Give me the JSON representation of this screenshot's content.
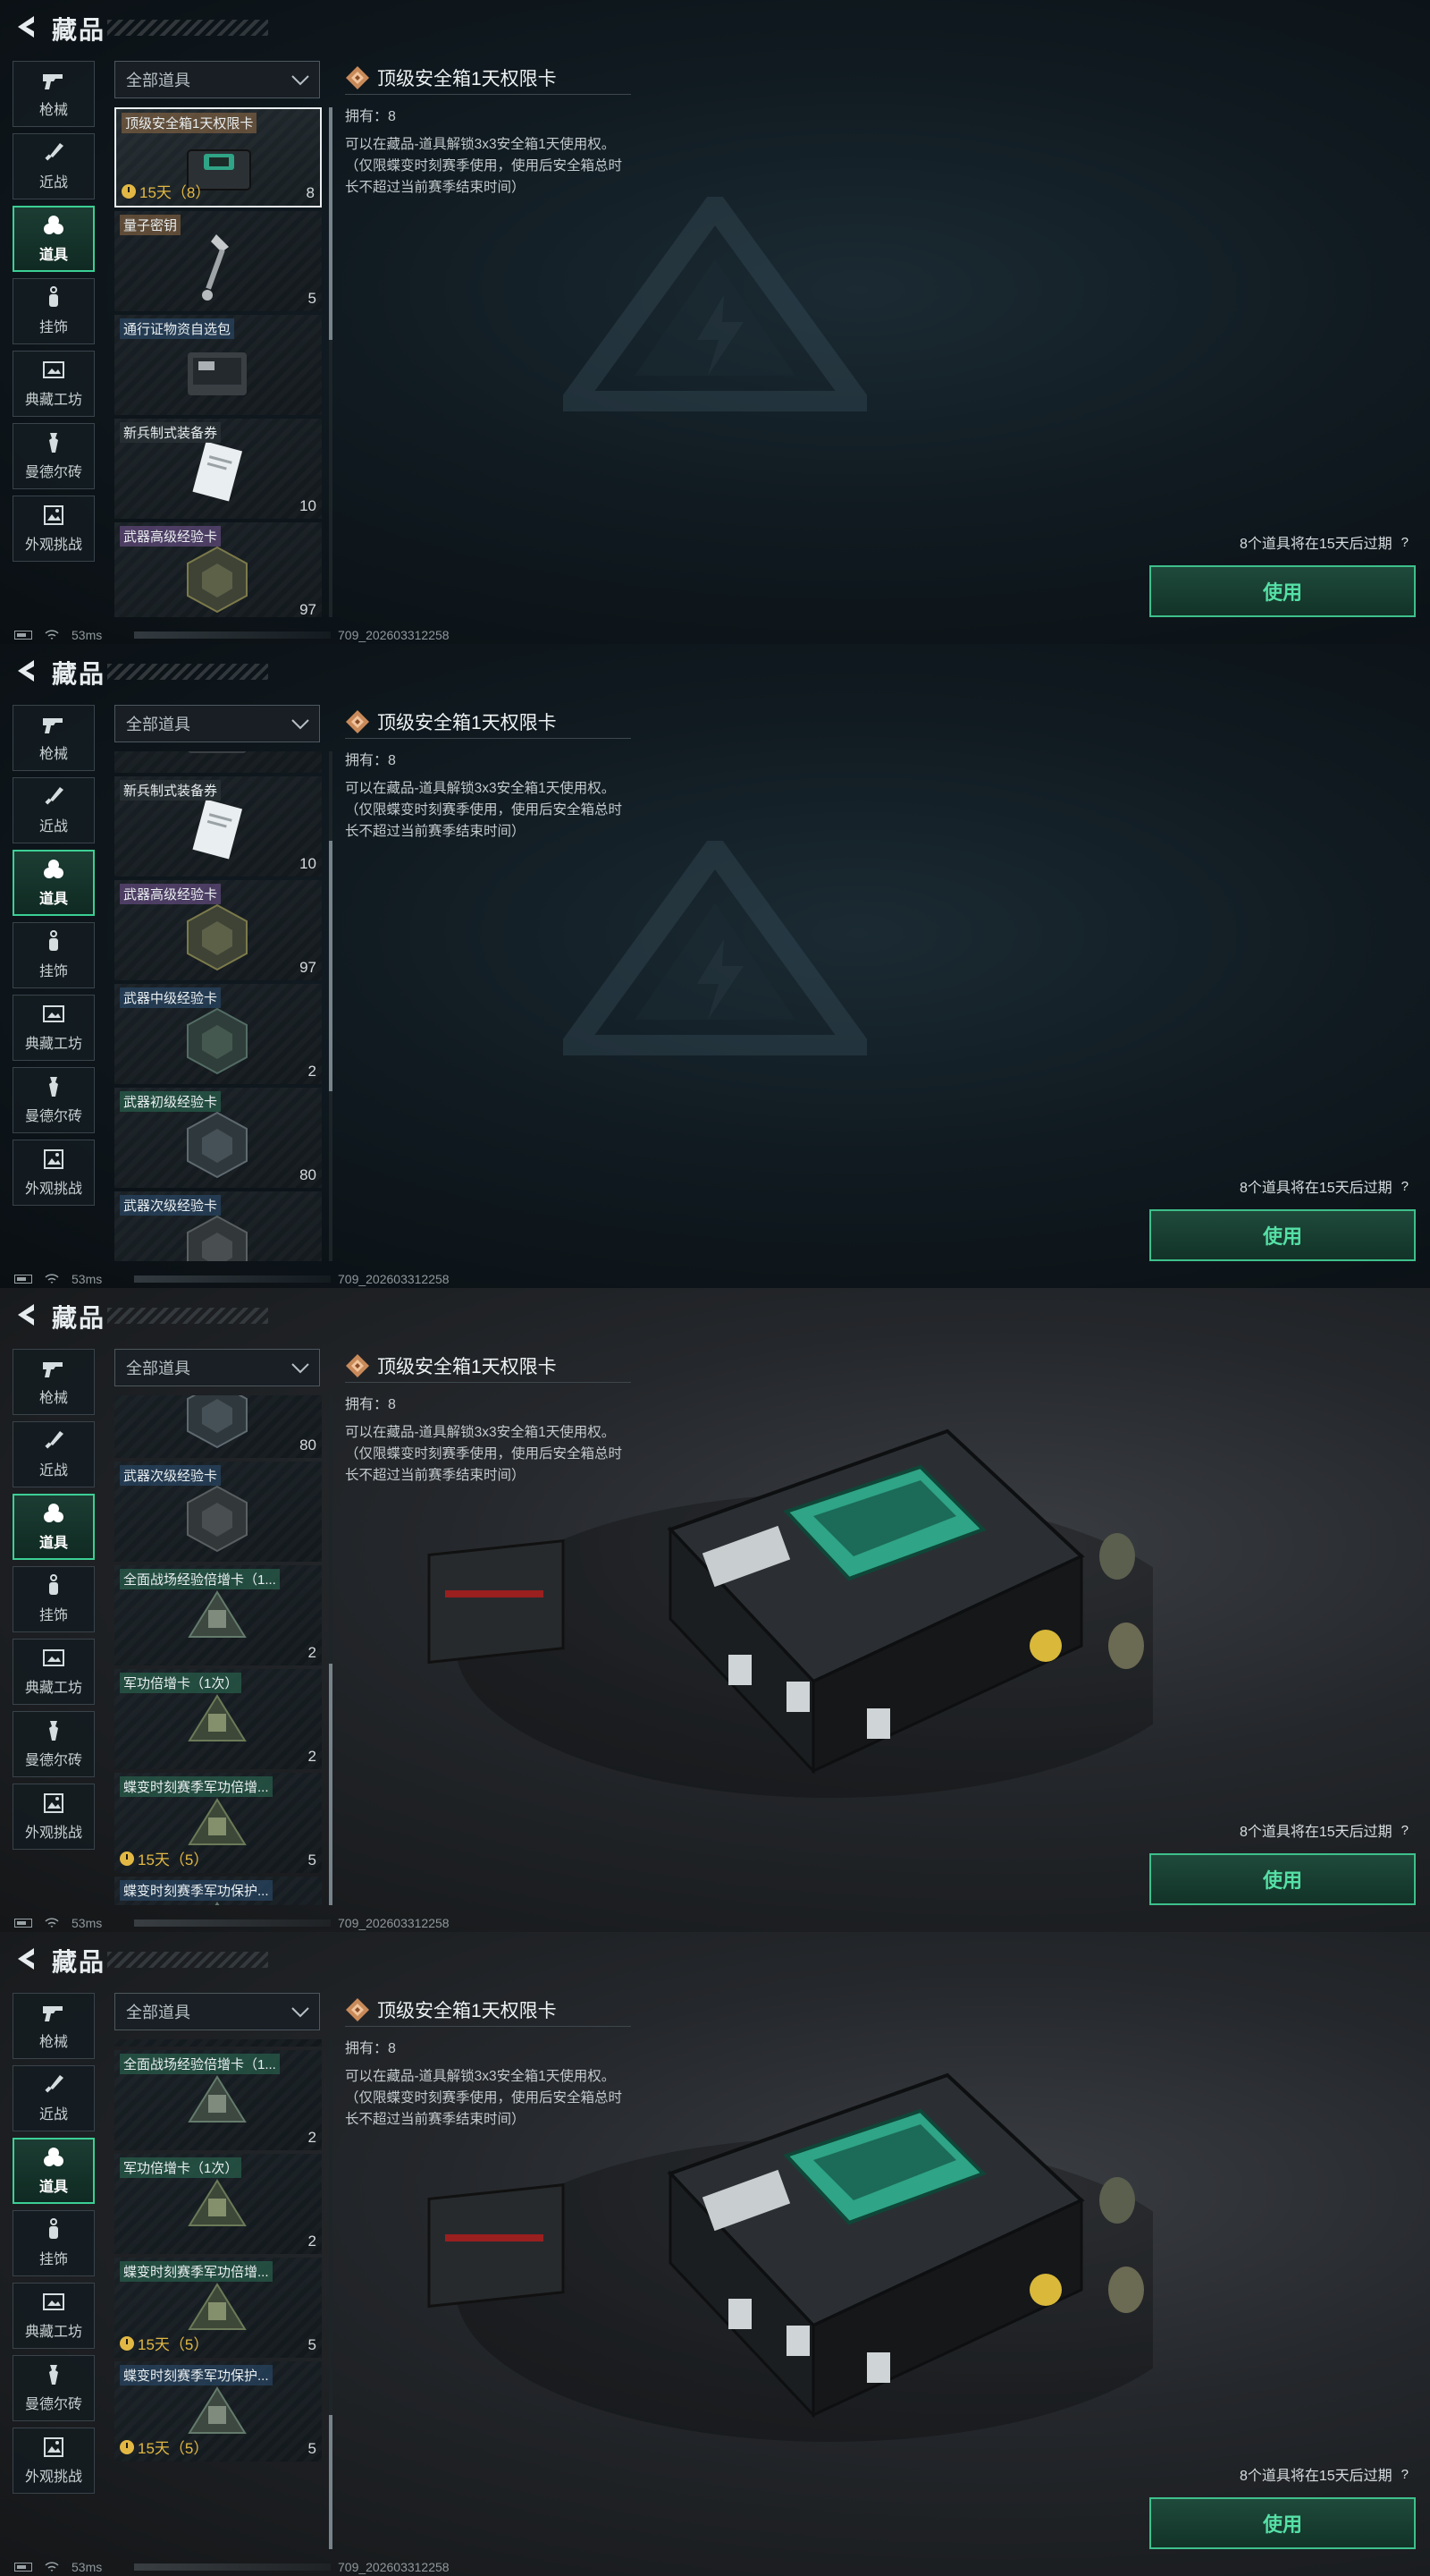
{
  "header": {
    "title": "藏品"
  },
  "nav": [
    {
      "label": "枪械",
      "icon": "pistol-icon"
    },
    {
      "label": "近战",
      "icon": "knife-icon"
    },
    {
      "label": "道具",
      "icon": "items-icon",
      "active": true
    },
    {
      "label": "挂饰",
      "icon": "charm-icon"
    },
    {
      "label": "典藏工坊",
      "icon": "workshop-icon"
    },
    {
      "label": "曼德尔砖",
      "icon": "mandel-brick-icon"
    },
    {
      "label": "外观挑战",
      "icon": "appearance-challenge-icon"
    }
  ],
  "filter": {
    "label": "全部道具"
  },
  "detail": {
    "title": "顶级安全箱1天权限卡",
    "owned": "拥有：8",
    "description": "可以在藏品-道具解锁3x3安全箱1天使用权。（仅限蝶变时刻赛季使用，使用后安全箱总时长不超过当前赛季结束时间）"
  },
  "expire_notice": "8个道具将在15天后过期",
  "help": "?",
  "use_button": "使用",
  "status": {
    "ping": "53ms",
    "build": "709_202603312258"
  },
  "items": {
    "topcard": {
      "name": "顶级安全箱1天权限卡",
      "qty": "8",
      "timer": "15天（8）"
    },
    "quantum": {
      "name": "量子密钥",
      "qty": "5"
    },
    "pass": {
      "name": "通行证物资自选包",
      "qty": ""
    },
    "recruit": {
      "name": "新兵制式装备券",
      "qty": "10"
    },
    "w_high": {
      "name": "武器高级经验卡",
      "qty": "97"
    },
    "w_mid": {
      "name": "武器中级经验卡",
      "qty": "2"
    },
    "w_low": {
      "name": "武器初级经验卡",
      "qty": "80"
    },
    "w_sub": {
      "name": "武器次级经验卡",
      "qty": ""
    },
    "field_exp": {
      "name": "全面战场经验倍增卡（1...",
      "qty": "2"
    },
    "merit": {
      "name": "军功倍增卡（1次）",
      "qty": "2"
    },
    "season_merit": {
      "name": "蝶变时刻赛季军功倍增...",
      "qty": "5",
      "timer": "15天（5）"
    },
    "season_protect": {
      "name": "蝶变时刻赛季军功保护...",
      "qty": "5",
      "timer": "15天（5）"
    }
  }
}
